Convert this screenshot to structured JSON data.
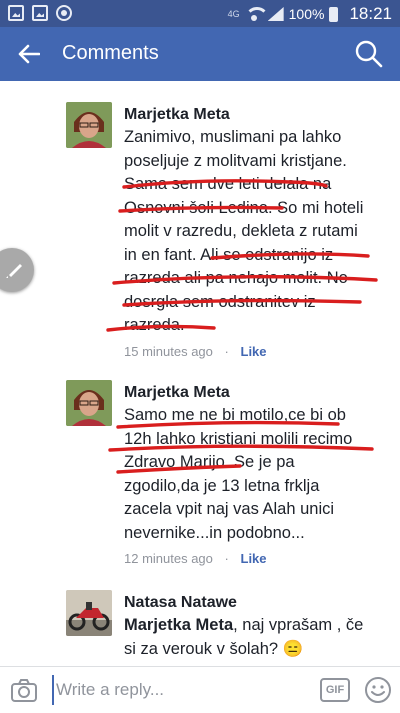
{
  "status_bar": {
    "network": "4G",
    "battery": "100%",
    "time": "18:21"
  },
  "header": {
    "title": "Comments"
  },
  "comments": [
    {
      "author": "Marjetka Meta",
      "text": "Zanimivo, muslimani pa lahko\nposeljuje z molitvami kristjane.\nSama sem dve leti delala na\nOsnovni šoli Ledina. So mi hoteli\nmolit v razredu, dekleta z rutami\nin en fant. Ali se odstranijo iz\nrazreda ali pa nehajo molit. No\ndosrgla sem odstranitev iz\nrazreda.",
      "time": "15 minutes ago",
      "action": "Like"
    },
    {
      "author": "Marjetka Meta",
      "text": "Samo me ne bi motilo,ce bi ob\n12h lahko kristjani molili recimo\nZdravo Marijo. Se je pa\nzgodilo,da je 13 letna frklja\nzacela vpit naj vas Alah unici\nnevernike...in podobno...",
      "time": "12 minutes ago",
      "action": "Like"
    },
    {
      "author": "Natasa Natawe",
      "mention": "Marjetka Meta",
      "text": ", naj vprašam , če\nsi za verouk v šolah? 😑"
    }
  ],
  "reply_bar": {
    "placeholder": "Write a reply...",
    "gif_label": "GIF"
  },
  "colors": {
    "header": "#4267b2",
    "status_bar": "#3b5591",
    "ink": "#d91e1e",
    "link": "#4267b2",
    "meta": "#90949c"
  }
}
